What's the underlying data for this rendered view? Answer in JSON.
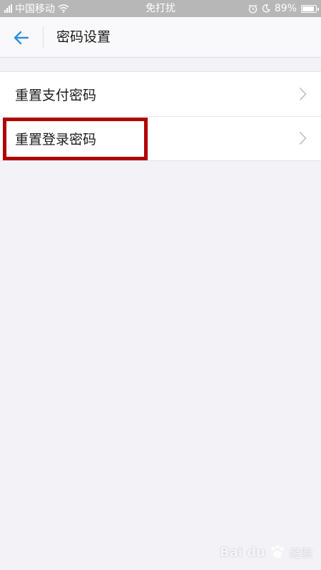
{
  "status_bar": {
    "carrier": "中国移动",
    "mode": "免打扰",
    "battery": "89%",
    "battery_level": 0.89,
    "icons": [
      "signal-icon",
      "wifi-icon",
      "alarm-icon",
      "moon-icon",
      "battery-icon"
    ]
  },
  "nav": {
    "back_icon": "arrow-left-icon",
    "title": "密码设置"
  },
  "list": {
    "items": [
      {
        "label": "重置支付密码"
      },
      {
        "label": "重置登录密码"
      }
    ]
  },
  "watermark": {
    "brand": "Bai du",
    "cn": "经验"
  },
  "colors": {
    "accent": "#2f8fde",
    "highlight": "#b10000",
    "background": "#f3f2f7",
    "status_bar": "#b7b7b7"
  }
}
